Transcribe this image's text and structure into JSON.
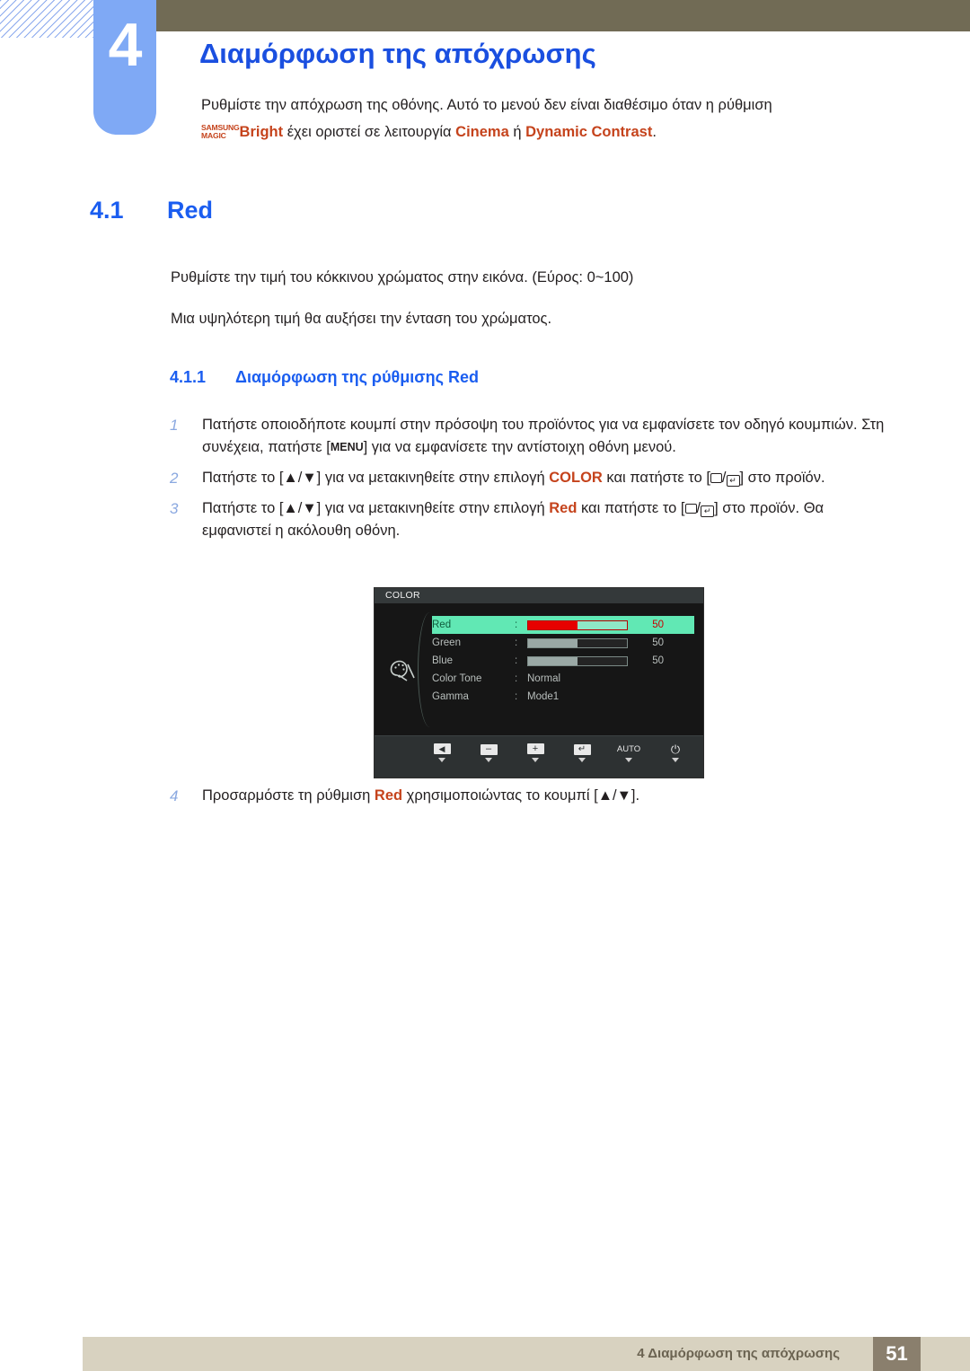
{
  "chapter": {
    "number": "4",
    "title": "Διαμόρφωση της απόχρωσης",
    "intro_before": "Ρυθμίστε την απόχρωση της οθόνης. Αυτό το μενού δεν είναι διαθέσιμο όταν η ρύθμιση ",
    "logo_line1": "SAMSUNG",
    "logo_line2": "MAGIC",
    "logo_word": "Bright",
    "intro_mid": " έχει οριστεί σε λειτουργία ",
    "intro_kw1": "Cinema",
    "intro_or": " ή ",
    "intro_kw2": "Dynamic Contrast",
    "intro_end": "."
  },
  "section": {
    "number": "4.1",
    "title": "Red",
    "paragraph1": "Ρυθμίστε την τιμή του κόκκινου χρώματος στην εικόνα. (Εύρος: 0~100)",
    "paragraph2": "Μια υψηλότερη τιμή θα αυξήσει την ένταση του χρώματος."
  },
  "subsection": {
    "number": "4.1.1",
    "title": "Διαμόρφωση της ρύθμισης Red"
  },
  "steps": [
    {
      "num": "1",
      "part1": "Πατήστε οποιοδήποτε κουμπί στην πρόσοψη του προϊόντος για να εμφανίσετε τον οδηγό κουμπιών. Στη συνέχεια, πατήστε [",
      "key": "MENU",
      "part2": "] για να εμφανίσετε την αντίστοιχη οθόνη μενού."
    },
    {
      "num": "2",
      "part1": "Πατήστε το [▲/▼] για να μετακινηθείτε στην επιλογή ",
      "keyword": "COLOR",
      "part2": " και πατήστε το [",
      "part3": "] στο προϊόν."
    },
    {
      "num": "3",
      "part1": "Πατήστε το [▲/▼] για να μετακινηθείτε στην επιλογή ",
      "keyword": "Red",
      "part2": " και πατήστε το [",
      "part3": "] στο προϊόν. Θα εμφανιστεί η ακόλουθη οθόνη."
    }
  ],
  "step4": {
    "num": "4",
    "part1": "Προσαρμόστε τη ρύθμιση ",
    "keyword": "Red",
    "part2": " χρησιμοποιώντας το κουμπί [▲/▼]."
  },
  "osd": {
    "title": "COLOR",
    "rows": [
      {
        "label": "Red",
        "colon": ":",
        "type": "bar",
        "value": "50",
        "fill_pct": 50,
        "highlight": true
      },
      {
        "label": "Green",
        "colon": ":",
        "type": "bar",
        "value": "50",
        "fill_pct": 50,
        "highlight": false
      },
      {
        "label": "Blue",
        "colon": ":",
        "type": "bar",
        "value": "50",
        "fill_pct": 50,
        "highlight": false
      },
      {
        "label": "Color Tone",
        "colon": ":",
        "type": "text",
        "value": "Normal",
        "highlight": false
      },
      {
        "label": "Gamma",
        "colon": ":",
        "type": "text",
        "value": "Mode1",
        "highlight": false
      }
    ],
    "footer_buttons": [
      {
        "name": "back-button",
        "glyph": "◀"
      },
      {
        "name": "minus-button",
        "glyph": "–"
      },
      {
        "name": "plus-button",
        "glyph": "+"
      },
      {
        "name": "enter-button",
        "glyph": "↵"
      },
      {
        "name": "auto-button",
        "glyph": "AUTO"
      },
      {
        "name": "power-button",
        "glyph": "⏻"
      }
    ]
  },
  "footer": {
    "text": "4 Διαμόρφωση της απόχρωσης",
    "page": "51"
  },
  "colors": {
    "chapter_tab": "#7fa9f5",
    "heading_blue": "#1a5df0",
    "keyword_red": "#c5431c",
    "topbar": "#716b55",
    "footer_bar": "#d8d2c0",
    "footer_page": "#8a7f6d",
    "osd_highlight": "#61e8b4",
    "osd_bar_red": "#e60000"
  }
}
